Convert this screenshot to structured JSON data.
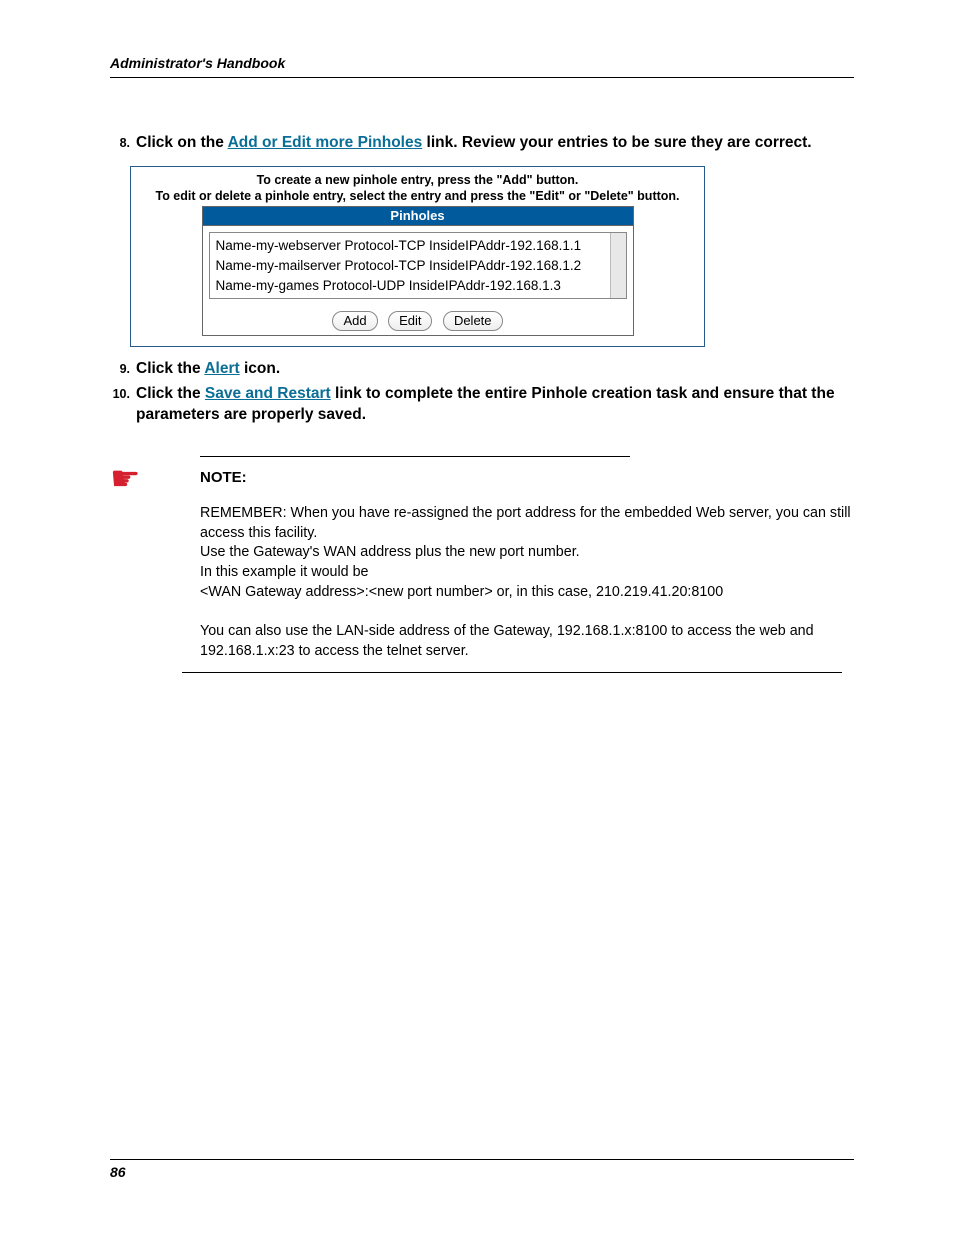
{
  "header": {
    "title": "Administrator's Handbook"
  },
  "steps": {
    "s8": {
      "num": "8.",
      "t1": "Click on the ",
      "link": "Add or Edit more Pinholes",
      "t2": " link. Review your entries to be sure they are correct."
    },
    "s9": {
      "num": "9.",
      "t1": "Click the ",
      "link": "Alert",
      "t2": " icon."
    },
    "s10": {
      "num": "10.",
      "t1": "Click the ",
      "link": "Save and Restart",
      "t2": " link to complete the entire Pinhole creation task and ensure that the parameters are properly saved."
    }
  },
  "pinhole": {
    "instr1": "To create a new pinhole entry, press the \"Add\" button.",
    "instr2": "To edit or delete a pinhole entry, select the entry and press the \"Edit\" or \"Delete\" button.",
    "header": "Pinholes",
    "rows": [
      "Name-my-webserver Protocol-TCP InsideIPAddr-192.168.1.1",
      "Name-my-mailserver Protocol-TCP InsideIPAddr-192.168.1.2",
      "Name-my-games Protocol-UDP InsideIPAddr-192.168.1.3"
    ],
    "buttons": {
      "add": "Add",
      "edit": "Edit",
      "del": "Delete"
    }
  },
  "note": {
    "label": "NOTE:",
    "p1": "REMEMBER: When you have re-assigned the port address for the embedded Web server, you can still access this facility.",
    "p2": "Use the Gateway's WAN address plus the new port number.",
    "p3": "In this example it would be",
    "p4": " <WAN Gateway address>:<new port number> or, in this case, 210.219.41.20:8100",
    "p5": "You can also use the LAN-side address of the Gateway, 192.168.1.x:8100 to access the web and 192.168.1.x:23 to access the telnet server."
  },
  "footer": {
    "page": "86"
  }
}
